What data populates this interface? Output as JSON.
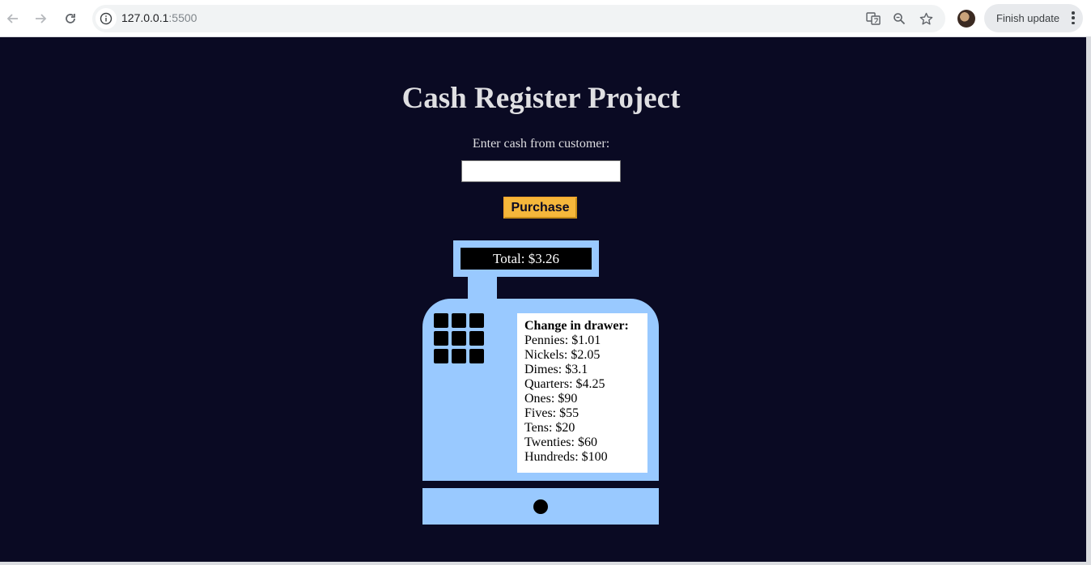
{
  "browser": {
    "url_host": "127.0.0.1",
    "url_port": ":5500",
    "update_label": "Finish update"
  },
  "page": {
    "title": "Cash Register Project",
    "cash_label": "Enter cash from customer:",
    "cash_input_value": "",
    "purchase_label": "Purchase",
    "total_text": "Total: $3.26",
    "drawer": {
      "title": "Change in drawer:",
      "items": [
        "Pennies: $1.01",
        "Nickels: $2.05",
        "Dimes: $3.1",
        "Quarters: $4.25",
        "Ones: $90",
        "Fives: $55",
        "Tens: $20",
        "Twenties: $60",
        "Hundreds: $100"
      ]
    }
  },
  "colors": {
    "background": "#0a0a23",
    "register": "#99c9ff",
    "button": "#f5b73b",
    "text_light": "#dfdfe2"
  }
}
